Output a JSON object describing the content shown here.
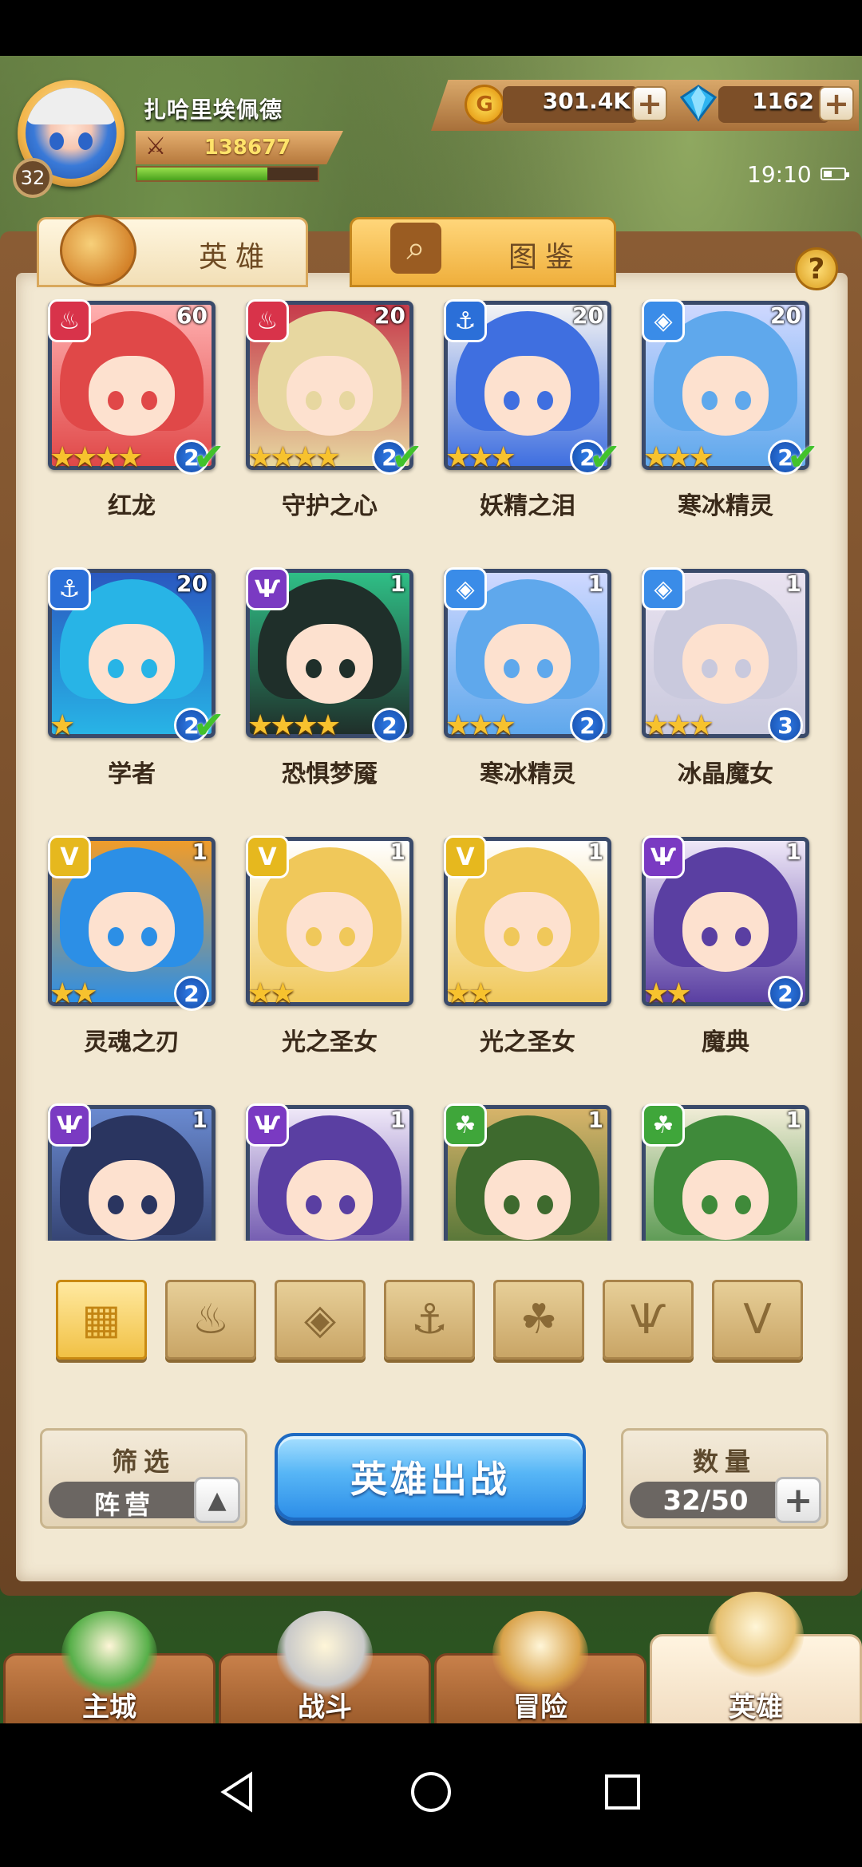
{
  "player": {
    "name": "扎哈里埃佩德",
    "level": "32",
    "power": "138677",
    "exp_fraction": 0.72
  },
  "resources": {
    "gold": "301.4K",
    "gems": "1162",
    "gold_icon_glyph": "G"
  },
  "status": {
    "time": "19:10"
  },
  "tabs": [
    {
      "label": "英雄",
      "icon": "helmet-icon",
      "active": true
    },
    {
      "label": "图鉴",
      "icon": "magnifier-icon",
      "active": false
    }
  ],
  "help_label": "?",
  "heroes": [
    {
      "name": "红龙",
      "level": "60",
      "stars": "★★★★",
      "rank": "2",
      "faction": "fire",
      "checked": true,
      "colors": [
        "#e04848",
        "#ffb0b0"
      ]
    },
    {
      "name": "守护之心",
      "level": "20",
      "stars": "★★★★",
      "rank": "2",
      "faction": "fire",
      "checked": true,
      "colors": [
        "#e7d7a0",
        "#c63a4a"
      ]
    },
    {
      "name": "妖精之泪",
      "level": "20",
      "stars": "★★★",
      "rank": "2",
      "faction": "water",
      "checked": true,
      "colors": [
        "#3f6fe0",
        "#f4f4f4"
      ]
    },
    {
      "name": "寒冰精灵",
      "level": "20",
      "stars": "★★★",
      "rank": "2",
      "faction": "ice",
      "checked": true,
      "colors": [
        "#5fa8ec",
        "#cfd8ff"
      ]
    },
    {
      "name": "学者",
      "level": "20",
      "stars": "★",
      "rank": "2",
      "faction": "water",
      "checked": true,
      "colors": [
        "#28b4e6",
        "#2a58c0"
      ]
    },
    {
      "name": "恐惧梦魇",
      "level": "1",
      "stars": "★★★★",
      "rank": "2",
      "faction": "dark",
      "checked": false,
      "colors": [
        "#1f2f2a",
        "#2fbf86"
      ]
    },
    {
      "name": "寒冰精灵",
      "level": "1",
      "stars": "★★★",
      "rank": "2",
      "faction": "ice",
      "checked": false,
      "colors": [
        "#5fa8ec",
        "#cfd8ff"
      ]
    },
    {
      "name": "冰晶魔女",
      "level": "1",
      "stars": "★★★",
      "rank": "3",
      "faction": "ice",
      "checked": false,
      "colors": [
        "#c9c9dd",
        "#e9e2f0"
      ]
    },
    {
      "name": "灵魂之刃",
      "level": "1",
      "stars": "★★",
      "rank": "2",
      "faction": "light",
      "checked": false,
      "colors": [
        "#2c8fe6",
        "#f09c2a"
      ]
    },
    {
      "name": "光之圣女",
      "level": "1",
      "stars": "★★",
      "rank": "",
      "faction": "light",
      "checked": false,
      "colors": [
        "#f0c85a",
        "#ffffff"
      ]
    },
    {
      "name": "光之圣女",
      "level": "1",
      "stars": "★★",
      "rank": "",
      "faction": "light",
      "checked": false,
      "colors": [
        "#f0c85a",
        "#ffffff"
      ]
    },
    {
      "name": "魔典",
      "level": "1",
      "stars": "★★",
      "rank": "2",
      "faction": "dark",
      "checked": false,
      "colors": [
        "#5a3fa2",
        "#efe8f8"
      ]
    },
    {
      "name": "",
      "level": "1",
      "stars": "",
      "rank": "",
      "faction": "dark",
      "checked": false,
      "colors": [
        "#2a3560",
        "#6a8ad0"
      ]
    },
    {
      "name": "",
      "level": "1",
      "stars": "",
      "rank": "",
      "faction": "dark",
      "checked": false,
      "colors": [
        "#5a3fa2",
        "#efe8f8"
      ]
    },
    {
      "name": "",
      "level": "1",
      "stars": "",
      "rank": "",
      "faction": "nature",
      "checked": false,
      "colors": [
        "#3e6a2e",
        "#d7b46a"
      ]
    },
    {
      "name": "",
      "level": "1",
      "stars": "",
      "rank": "",
      "faction": "nature",
      "checked": false,
      "colors": [
        "#3f8a3a",
        "#f0ecd6"
      ]
    }
  ],
  "faction_styles": {
    "fire": {
      "color": "#d8334a",
      "glyph": "♨"
    },
    "water": {
      "color": "#2b6fd8",
      "glyph": "⚓"
    },
    "ice": {
      "color": "#3a8ce8",
      "glyph": "◈"
    },
    "dark": {
      "color": "#7a3ac2",
      "glyph": "Ѱ"
    },
    "light": {
      "color": "#e6b81e",
      "glyph": "V"
    },
    "nature": {
      "color": "#3fa63a",
      "glyph": "☘"
    }
  },
  "filters": [
    {
      "name": "all",
      "glyph": "▦",
      "active": true
    },
    {
      "name": "fire",
      "glyph": "♨",
      "active": false
    },
    {
      "name": "ice",
      "glyph": "◈",
      "active": false
    },
    {
      "name": "water",
      "glyph": "⚓",
      "active": false
    },
    {
      "name": "nature",
      "glyph": "☘",
      "active": false
    },
    {
      "name": "dark",
      "glyph": "Ѱ",
      "active": false
    },
    {
      "name": "light",
      "glyph": "V",
      "active": false
    }
  ],
  "controls": {
    "filter_title": "筛选",
    "faction_value": "阵营",
    "deploy_label": "英雄出战",
    "count_title": "数量",
    "count_value": "32/50",
    "plus": "+",
    "toggle": "▲"
  },
  "nav": [
    {
      "label": "主城",
      "icon": "castle-icon",
      "active": false,
      "color": "#58b04a"
    },
    {
      "label": "战斗",
      "icon": "crossed-swords-icon",
      "active": false,
      "color": "#c9c9c9"
    },
    {
      "label": "冒险",
      "icon": "map-scroll-icon",
      "active": false,
      "color": "#d9a24a"
    },
    {
      "label": "英雄",
      "icon": "hero-helmet-icon",
      "active": true,
      "color": "#e6c070"
    }
  ]
}
